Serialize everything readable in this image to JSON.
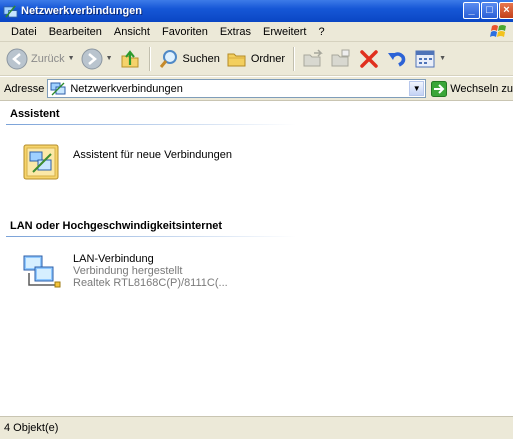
{
  "window": {
    "title": "Netzwerkverbindungen"
  },
  "menu": [
    "Datei",
    "Bearbeiten",
    "Ansicht",
    "Favoriten",
    "Extras",
    "Erweitert",
    "?"
  ],
  "toolbar": {
    "back_label": "Zurück",
    "search_label": "Suchen",
    "folders_label": "Ordner"
  },
  "address": {
    "label": "Adresse",
    "value": "Netzwerkverbindungen",
    "go_label": "Wechseln zu"
  },
  "groups": [
    {
      "title": "Assistent",
      "items": [
        {
          "name": "Assistent für neue Verbindungen",
          "icon": "wizard-icon"
        }
      ]
    },
    {
      "title": "LAN oder Hochgeschwindigkeitsinternet",
      "items": [
        {
          "name": "LAN-Verbindung",
          "status": "Verbindung hergestellt",
          "device": "Realtek RTL8168C(P)/8111C(...",
          "icon": "network-connection-icon"
        }
      ]
    }
  ],
  "status": {
    "text": "4 Objekt(e)"
  },
  "colors": {
    "titlebar": "#0a46c4",
    "chrome": "#ece9d8",
    "group_line": "#7aa2d8"
  }
}
